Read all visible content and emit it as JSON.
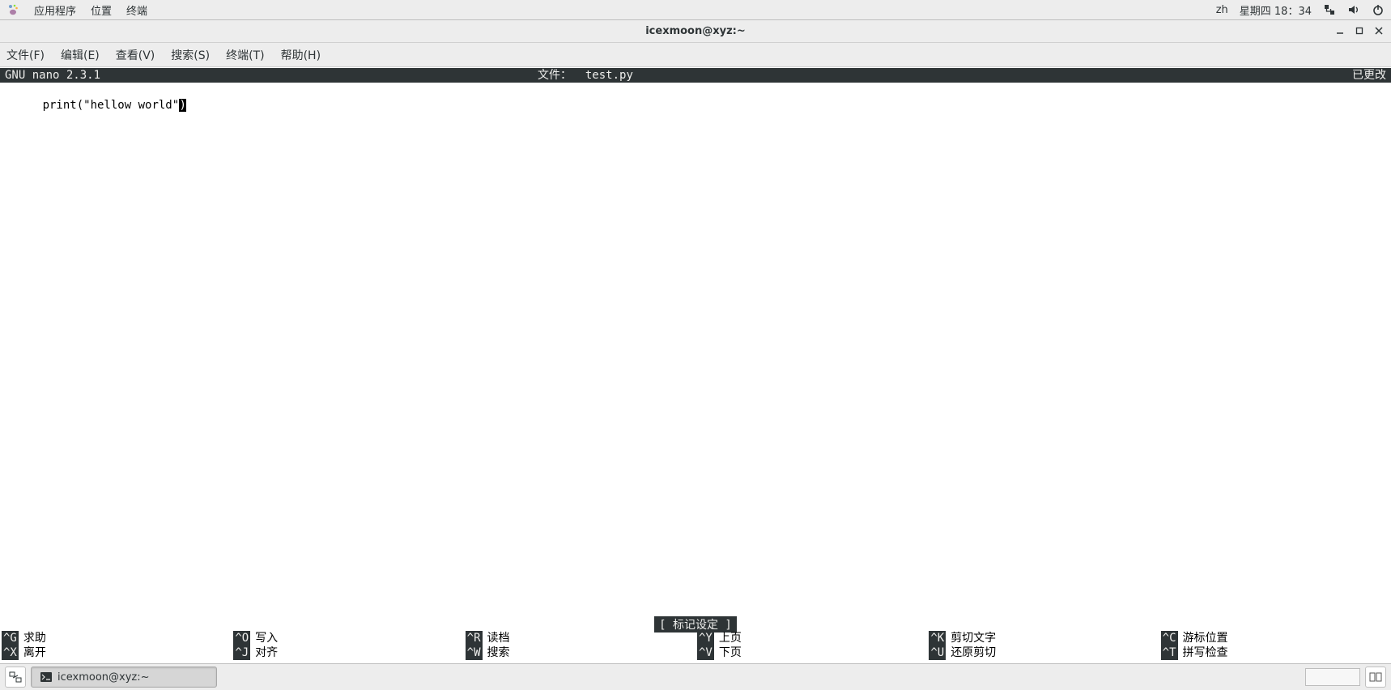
{
  "panel": {
    "apps": "应用程序",
    "places": "位置",
    "terminal": "终端",
    "lang": "zh",
    "datetime": "星期四 18：34"
  },
  "window": {
    "title": "icexmoon@xyz:~"
  },
  "menu": {
    "file": "文件(F)",
    "edit": "编辑(E)",
    "view": "查看(V)",
    "search": "搜索(S)",
    "terminal": "终端(T)",
    "help": "帮助(H)"
  },
  "nano": {
    "app": "GNU nano 2.3.1",
    "file_label": "文件：",
    "filename": "test.py",
    "modified": "已更改",
    "content": "print(\"hellow world\"",
    "cursor_char": ")",
    "mark": "[ 标记设定 ]",
    "shortcuts_row1": [
      {
        "key": "^G",
        "label": "求助"
      },
      {
        "key": "^O",
        "label": "写入"
      },
      {
        "key": "^R",
        "label": "读档"
      },
      {
        "key": "^Y",
        "label": "上页"
      },
      {
        "key": "^K",
        "label": "剪切文字"
      },
      {
        "key": "^C",
        "label": "游标位置"
      }
    ],
    "shortcuts_row2": [
      {
        "key": "^X",
        "label": "离开"
      },
      {
        "key": "^J",
        "label": "对齐"
      },
      {
        "key": "^W",
        "label": "搜索"
      },
      {
        "key": "^V",
        "label": "下页"
      },
      {
        "key": "^U",
        "label": "还原剪切"
      },
      {
        "key": "^T",
        "label": "拼写检查"
      }
    ]
  },
  "taskbar": {
    "task_label": "icexmoon@xyz:~"
  }
}
